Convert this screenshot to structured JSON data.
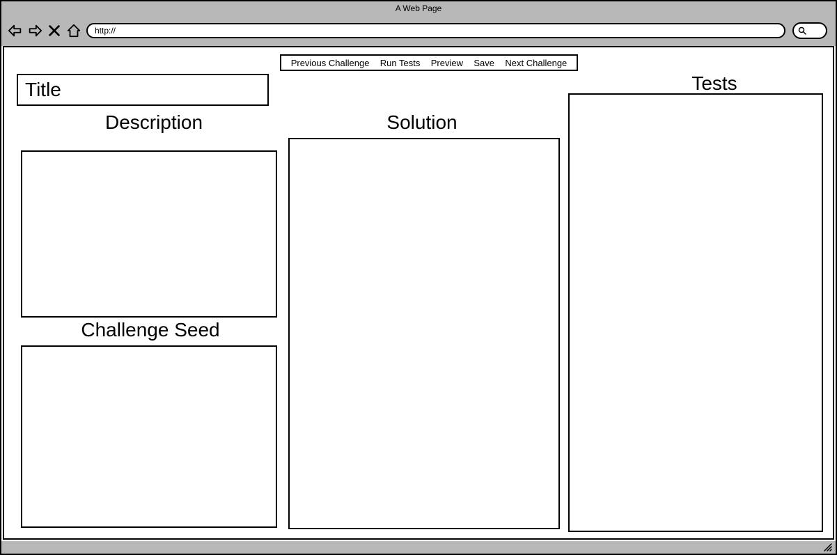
{
  "browser": {
    "title": "A Web Page",
    "url": "http://"
  },
  "menu": {
    "previous": "Previous Challenge",
    "run_tests": "Run Tests",
    "preview": "Preview",
    "save": "Save",
    "next": "Next Challenge"
  },
  "fields": {
    "title_placeholder": "Title"
  },
  "labels": {
    "description": "Description",
    "challenge_seed": "Challenge Seed",
    "solution": "Solution",
    "tests": "Tests"
  }
}
